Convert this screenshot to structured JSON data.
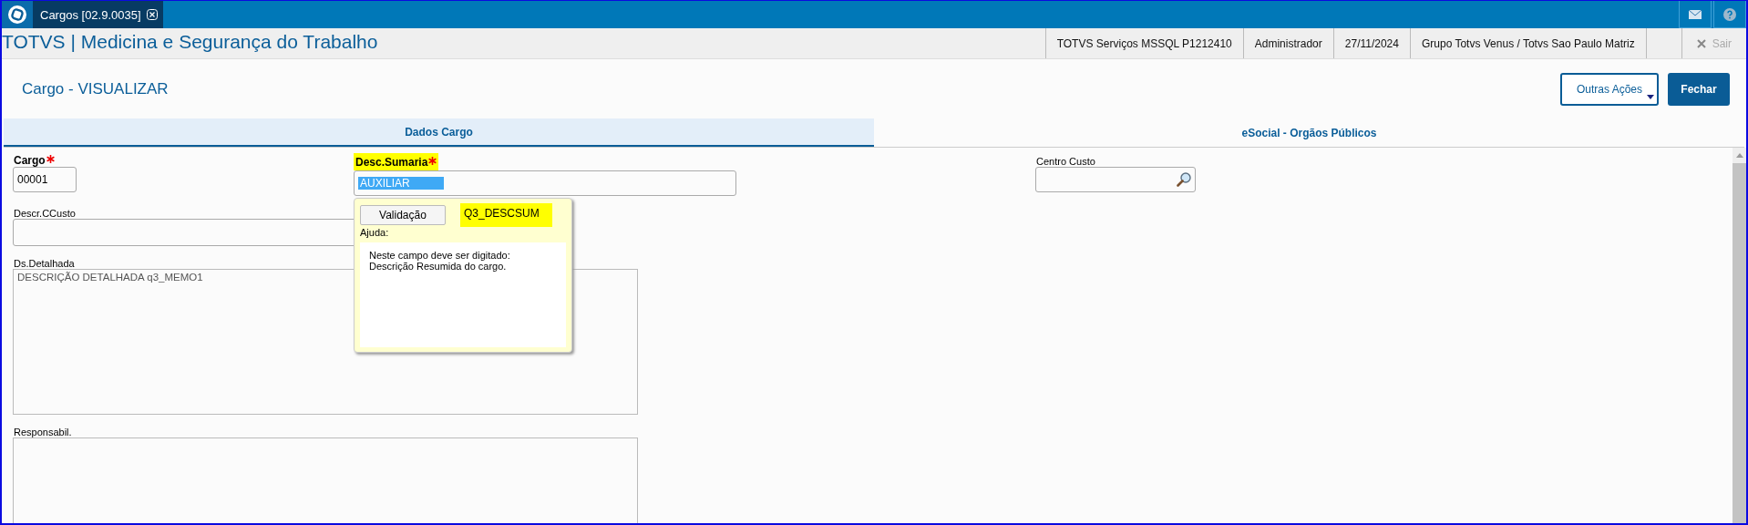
{
  "app_tabs": [
    {
      "label": "Cargos [02.9.0035]",
      "selected": true
    }
  ],
  "header": {
    "title": "TOTVS | Medicina e Segurança do Trabalho",
    "info": [
      "TOTVS Serviços MSSQL P1212410",
      "Administrador",
      "27/11/2024",
      "Grupo Totvs Venus / Totvs Sao Paulo Matriz"
    ],
    "exit": {
      "label": "Sair",
      "disabled": true
    }
  },
  "page": {
    "title": "Cargo - VISUALIZAR",
    "buttons": [
      {
        "label": "Outras Ações",
        "kind": "menu"
      },
      {
        "label": "Fechar",
        "kind": "primary"
      }
    ]
  },
  "tabs": [
    {
      "label": "Dados Cargo",
      "selected": true
    },
    {
      "label": "eSocial - Orgãos Públicos",
      "selected": false
    }
  ],
  "fields": [
    {
      "label": "Cargo",
      "required": true,
      "highlighted": false,
      "value": "00001",
      "kind": "short"
    },
    {
      "label": "Desc.Sumaria",
      "required": true,
      "highlighted": true,
      "value": "AUXILIAR",
      "kind": "selected"
    },
    {
      "label": "Centro Custo",
      "required": false,
      "highlighted": false,
      "kind": "lookup"
    },
    {
      "label": "Descr.CCusto",
      "required": false,
      "highlighted": false,
      "kind": "wide"
    },
    {
      "label": "Ds.Detalhada",
      "required": false,
      "highlighted": false,
      "value": "DESCRIÇÃO DETALHADA q3_MEMO1",
      "kind": "memo"
    },
    {
      "label": "Responsabil.",
      "required": false,
      "highlighted": false,
      "kind": "memo"
    }
  ],
  "help_popup": {
    "button": "Validação",
    "field_id": "Q3_DESCSUM",
    "field_id_highlighted": true,
    "label": "Ajuda:",
    "text": [
      "Neste campo deve ser digitado:",
      "Descrição Resumida do cargo."
    ]
  }
}
